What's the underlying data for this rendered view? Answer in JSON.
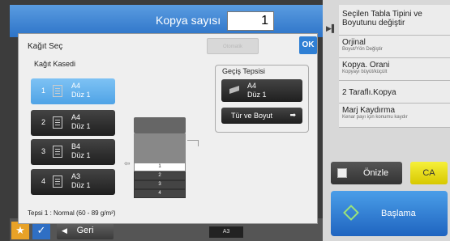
{
  "header": {
    "copies_label": "Kopya sayısı",
    "copies_value": "1"
  },
  "right_panel": {
    "items": [
      {
        "title": "Seçilen Tabla Tipini ve Boyutunu değiştir",
        "sub": ""
      },
      {
        "title": "Orjinal",
        "sub": "Boyut/Yön Değiştir"
      },
      {
        "title": "Kopya. Orani",
        "sub": "Kopyayı büyüt/küçült"
      },
      {
        "title": "2 Taraflı.Kopya",
        "sub": ""
      },
      {
        "title": "Marj Kaydırma",
        "sub": "Kenar payı için konumu kaydır"
      }
    ],
    "preview_label": "Önizle",
    "ca_label": "CA",
    "start_label": "Başlama"
  },
  "bottom_bar": {
    "back_label": "Geri",
    "mini_tray": "A3"
  },
  "dialog": {
    "title": "Kağıt Seç",
    "disabled_button": "Otomatik",
    "ok_label": "OK",
    "cassette_label": "Kağıt Kasedi",
    "trays": [
      {
        "num": "1",
        "size": "A4",
        "type": "Düz 1",
        "selected": true
      },
      {
        "num": "2",
        "size": "A4",
        "type": "Düz 1",
        "selected": false
      },
      {
        "num": "3",
        "size": "B4",
        "type": "Düz 1",
        "selected": false
      },
      {
        "num": "4",
        "size": "A3",
        "type": "Düz 1",
        "selected": false
      }
    ],
    "bypass": {
      "label": "Geçiş Tepsisi",
      "size": "A4",
      "type": "Düz 1",
      "type_button": "Tür ve Boyut"
    },
    "printer_trays": [
      "1",
      "2",
      "3",
      "4"
    ],
    "footer": "Tepsi 1 : Normal (60 - 89 g/m²)"
  }
}
